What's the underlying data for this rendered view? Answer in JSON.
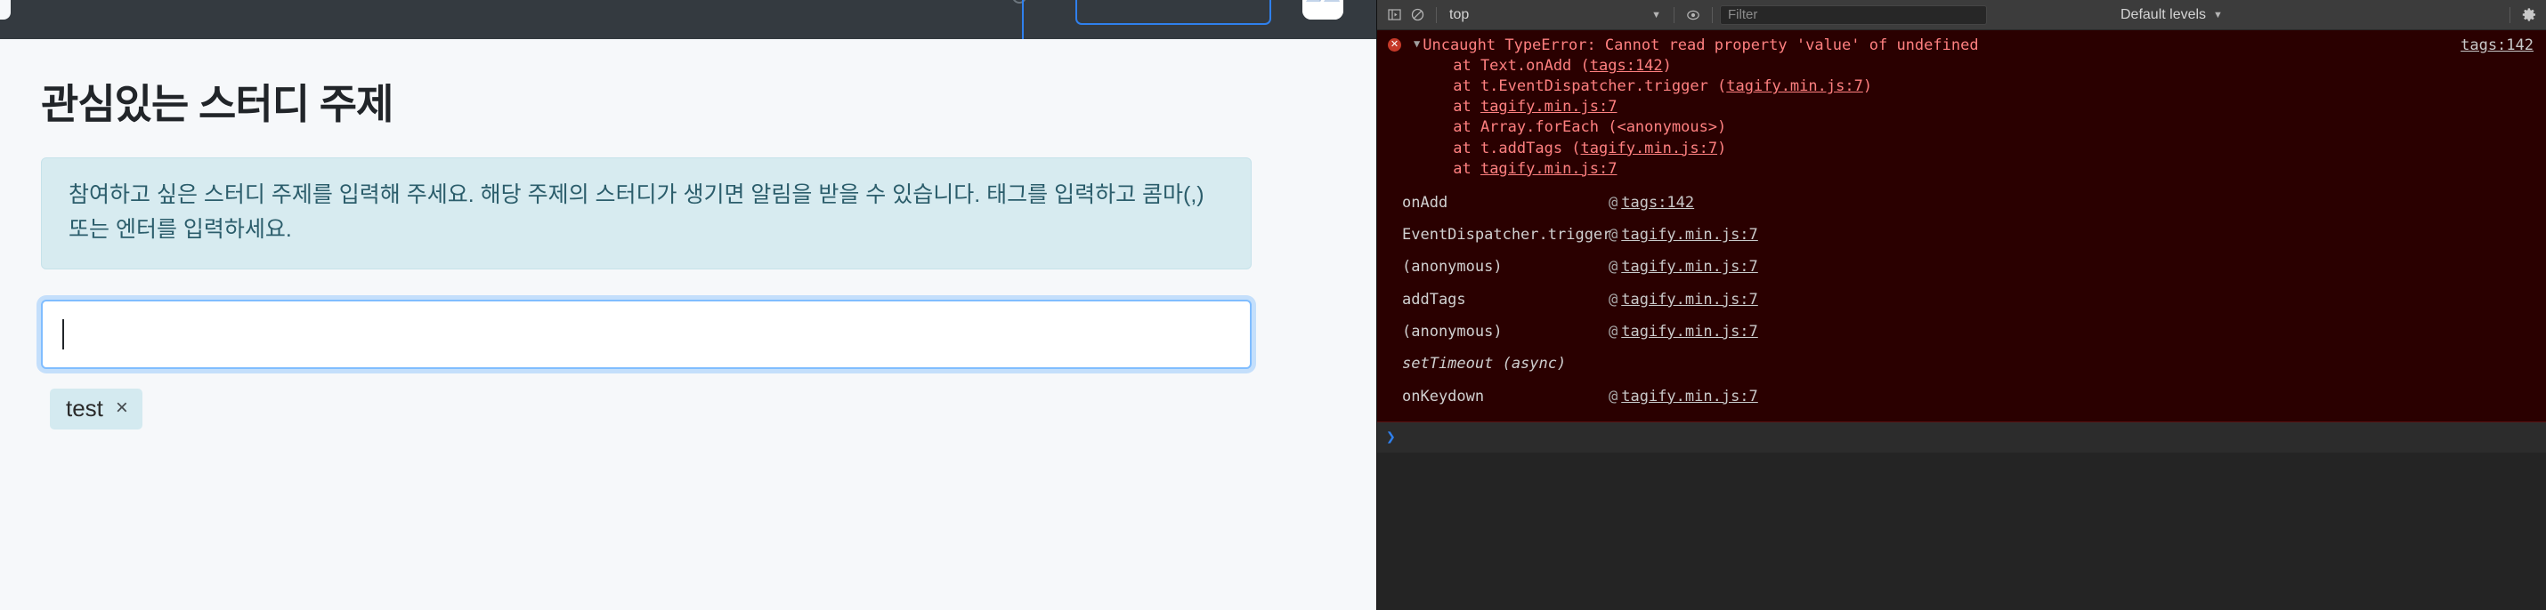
{
  "page": {
    "navbar": {
      "faint_text": "· · ·· ▭▭▭",
      "avatar_name": "user-avatar"
    },
    "title": "관심있는 스터디 주제",
    "alert_text": "참여하고 싶은 스터디 주제를 입력해 주세요. 해당 주제의 스터디가 생기면 알림을 받을 수 있습니다. 태그를 입력하고 콤마(,) 또는 엔터를 입력하세요.",
    "tag_input": {
      "value": "",
      "placeholder": ""
    },
    "tags": [
      {
        "label": "test",
        "remove": "×"
      }
    ]
  },
  "devtools": {
    "toolbar": {
      "sidebar_toggle": "show-console-sidebar",
      "clear_console": "clear-console",
      "context_value": "top",
      "context_caret": "▼",
      "eye_icon": "live-expression",
      "filter_placeholder": "Filter",
      "filter_value": "",
      "levels_label": "Default levels",
      "levels_caret": "▼",
      "settings_icon": "gear-icon"
    },
    "error": {
      "badge": "✕",
      "expander": "▼",
      "title": "Uncaught TypeError: Cannot read property 'value' of undefined",
      "source": "tags:142",
      "frames": [
        {
          "prefix": "    at Text.onAdd (",
          "link": "tags:142",
          "suffix": ")"
        },
        {
          "prefix": "    at t.EventDispatcher.trigger (",
          "link": "tagify.min.js:7",
          "suffix": ")"
        },
        {
          "prefix": "    at ",
          "link": "tagify.min.js:7",
          "suffix": ""
        },
        {
          "prefix": "    at Array.forEach (<anonymous>)",
          "link": "",
          "suffix": ""
        },
        {
          "prefix": "    at t.addTags (",
          "link": "tagify.min.js:7",
          "suffix": ")"
        },
        {
          "prefix": "    at ",
          "link": "tagify.min.js:7",
          "suffix": ""
        }
      ],
      "stack": [
        {
          "fn": "onAdd",
          "at": "@",
          "loc": "tags:142",
          "async": false
        },
        {
          "fn": "EventDispatcher.trigger",
          "at": "@",
          "loc": "tagify.min.js:7",
          "async": false
        },
        {
          "fn": "(anonymous)",
          "at": "@",
          "loc": "tagify.min.js:7",
          "async": false
        },
        {
          "fn": "addTags",
          "at": "@",
          "loc": "tagify.min.js:7",
          "async": false
        },
        {
          "fn": "(anonymous)",
          "at": "@",
          "loc": "tagify.min.js:7",
          "async": false
        },
        {
          "fn": "setTimeout (async)",
          "at": "",
          "loc": "",
          "async": true
        },
        {
          "fn": "onKeydown",
          "at": "@",
          "loc": "tagify.min.js:7",
          "async": false
        }
      ]
    },
    "prompt": {
      "caret": "❯",
      "value": ""
    }
  },
  "colors": {
    "navbar_bg": "#343a40",
    "page_bg": "#f6f8fa",
    "alert_bg": "#d7ebf0",
    "alert_text": "#2b5d6b",
    "focus_blue": "#80bdff",
    "tag_bg": "#d4eaf0",
    "console_bg": "#242424",
    "error_bg": "#2a0000",
    "error_text": "#ff8080",
    "accent_blue": "#2f80ed"
  }
}
